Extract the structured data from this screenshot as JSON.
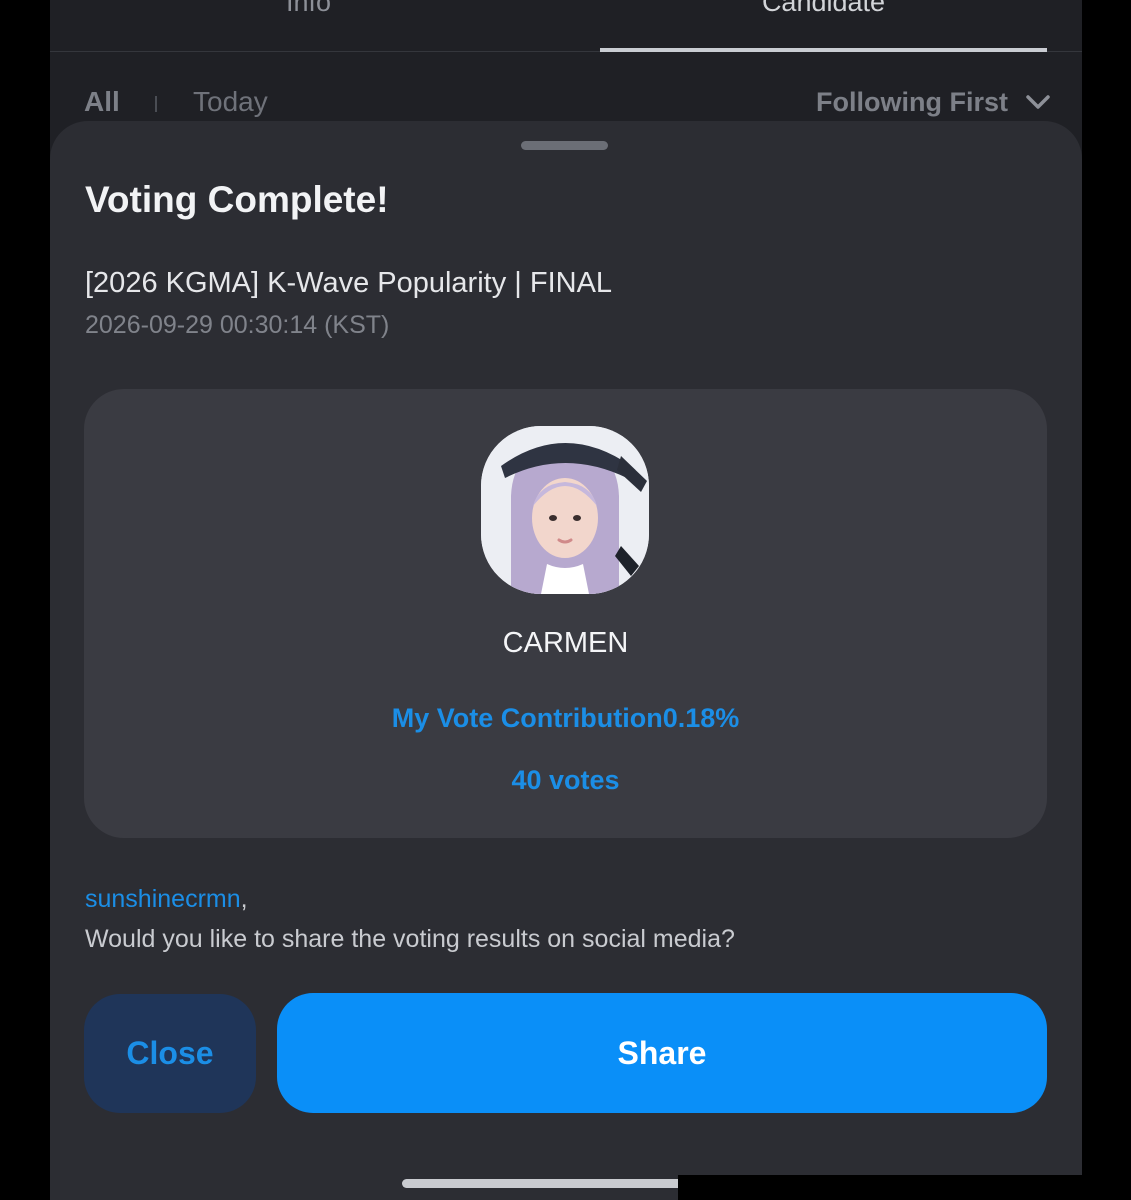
{
  "tabs": {
    "info": "Info",
    "candidate": "Candidate"
  },
  "filters": {
    "all": "All",
    "today": "Today",
    "sort": "Following First"
  },
  "sheet": {
    "title": "Voting Complete!",
    "event": "[2026 KGMA] K-Wave Popularity | FINAL",
    "datetime": "2026-09-29 00:30:14 (KST)",
    "candidate_name": "CARMEN",
    "contribution": "My Vote Contribution0.18%",
    "votes": "40 votes",
    "username": "sunshinecrmn",
    "comma": ",",
    "question": "Would you like to share the voting results on social media?",
    "close_label": "Close",
    "share_label": "Share"
  },
  "colors": {
    "accent": "#1b8ee6",
    "share_button": "#0a8ff8",
    "close_button": "#1f3559",
    "sheet_bg": "#2c2d33",
    "card_bg": "#3a3b42"
  },
  "icons": {
    "sort": "chevron-down-icon",
    "avatar": "candidate-photo"
  }
}
